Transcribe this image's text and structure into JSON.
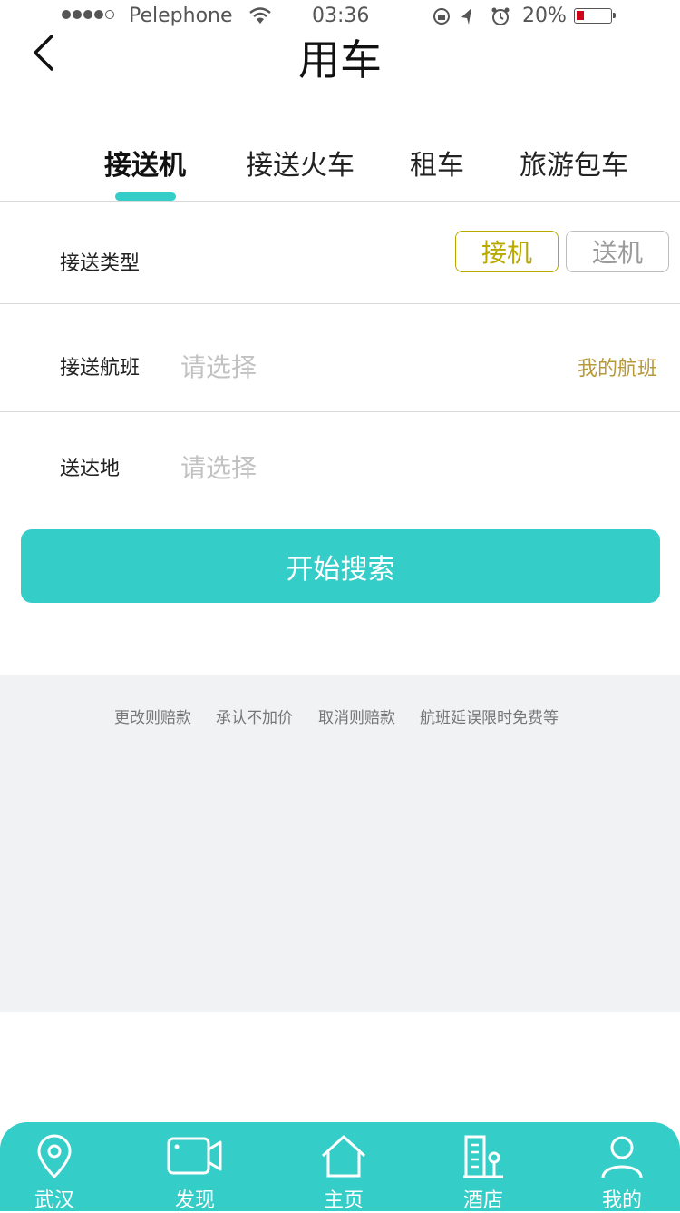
{
  "status_bar": {
    "carrier": "Pelephone",
    "time": "03:36",
    "battery": "20%",
    "battery_level": 0.2
  },
  "header": {
    "title": "用车"
  },
  "tabs": [
    {
      "label": "接送机",
      "active": true
    },
    {
      "label": "接送火车",
      "active": false
    },
    {
      "label": "租车",
      "active": false
    },
    {
      "label": "旅游包车",
      "active": false
    }
  ],
  "form": {
    "type_label": "接送类型",
    "type_options": [
      "接机",
      "送机"
    ],
    "type_selected": "接机",
    "flight_label": "接送航班",
    "flight_placeholder": "请选择",
    "my_flight_link": "我的航班",
    "dest_label": "送达地",
    "dest_placeholder": "请选择",
    "search_button": "开始搜索"
  },
  "features": [
    "更改则赔款",
    "承认不加价",
    "取消则赔款",
    "航班延误限时免费等"
  ],
  "bottom_nav": [
    {
      "label": "武汉",
      "icon": "location-pin-icon"
    },
    {
      "label": "发现",
      "icon": "video-camera-icon"
    },
    {
      "label": "主页",
      "icon": "home-icon"
    },
    {
      "label": "酒店",
      "icon": "hotel-icon"
    },
    {
      "label": "我的",
      "icon": "user-icon"
    }
  ],
  "colors": {
    "accent": "#34cdc8",
    "selected_gold": "#b8a900",
    "link_gold": "#b89a3a",
    "gray_panel": "#f1f2f4"
  }
}
